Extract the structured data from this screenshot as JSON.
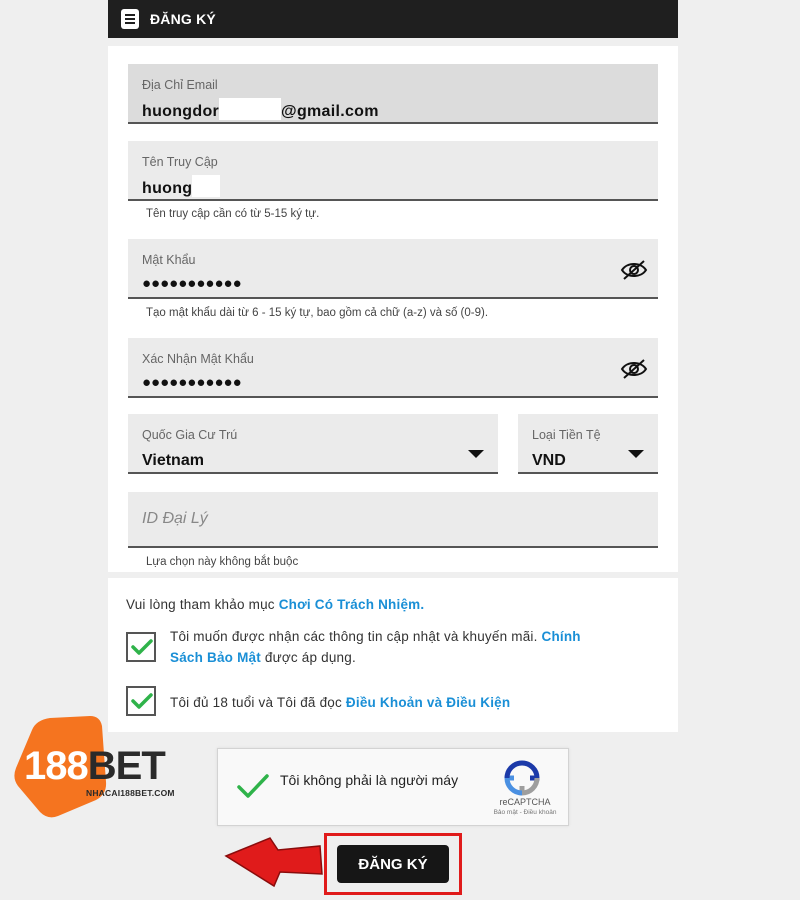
{
  "header": {
    "title": "ĐĂNG KÝ",
    "icon": "document-icon"
  },
  "form": {
    "email": {
      "label": "Địa Chỉ Email",
      "value_prefix": "huongdor",
      "value_suffix": "@gmail.com"
    },
    "username": {
      "label": "Tên Truy Cập",
      "value": "huong",
      "hint": "Tên truy cập cần có từ 5-15 ký tự."
    },
    "password": {
      "label": "Mật Khẩu",
      "value": "●●●●●●●●●●●",
      "hint": "Tạo mật khẩu dài từ 6 - 15 ký tự, bao gồm cả chữ (a-z) và số (0-9)."
    },
    "confirm_password": {
      "label": "Xác Nhận Mật Khẩu",
      "value": "●●●●●●●●●●●"
    },
    "country": {
      "label": "Quốc Gia Cư Trú",
      "value": "Vietnam"
    },
    "currency": {
      "label": "Loại Tiền Tệ",
      "value": "VND"
    },
    "agent": {
      "placeholder": "ID Đại Lý",
      "hint": "Lựa chọn này không bắt buộc"
    }
  },
  "consent": {
    "intro_text": "Vui lòng tham khảo mục ",
    "intro_link": "Chơi Có Trách Nhiệm.",
    "promo_text": "Tôi muốn được nhận các thông tin cập nhật và khuyến mãi. ",
    "promo_link_1": "Chính",
    "promo_link_2": "Sách Bảo Mật",
    "promo_text_2": " được áp dụng.",
    "promo_checked": true,
    "age_text": "Tôi đủ 18 tuổi và Tôi đã đọc ",
    "age_link": "Điều Khoản và Điều Kiện",
    "age_checked": true
  },
  "recaptcha": {
    "label": "Tôi không phải là người máy",
    "brand": "reCAPTCHA",
    "terms": "Bảo mật - Điều khoản",
    "checked": true
  },
  "logo": {
    "word_num": "188",
    "word_bet": "BET",
    "subtitle": "NHACAI188BET.COM"
  },
  "submit": {
    "label": "ĐĂNG KÝ"
  },
  "colors": {
    "accent_link": "#1a8fd6",
    "check_green": "#2fb34a",
    "logo_orange": "#f5741f",
    "highlight_red": "#e01b1b",
    "header_bg": "#1f1f1f"
  }
}
